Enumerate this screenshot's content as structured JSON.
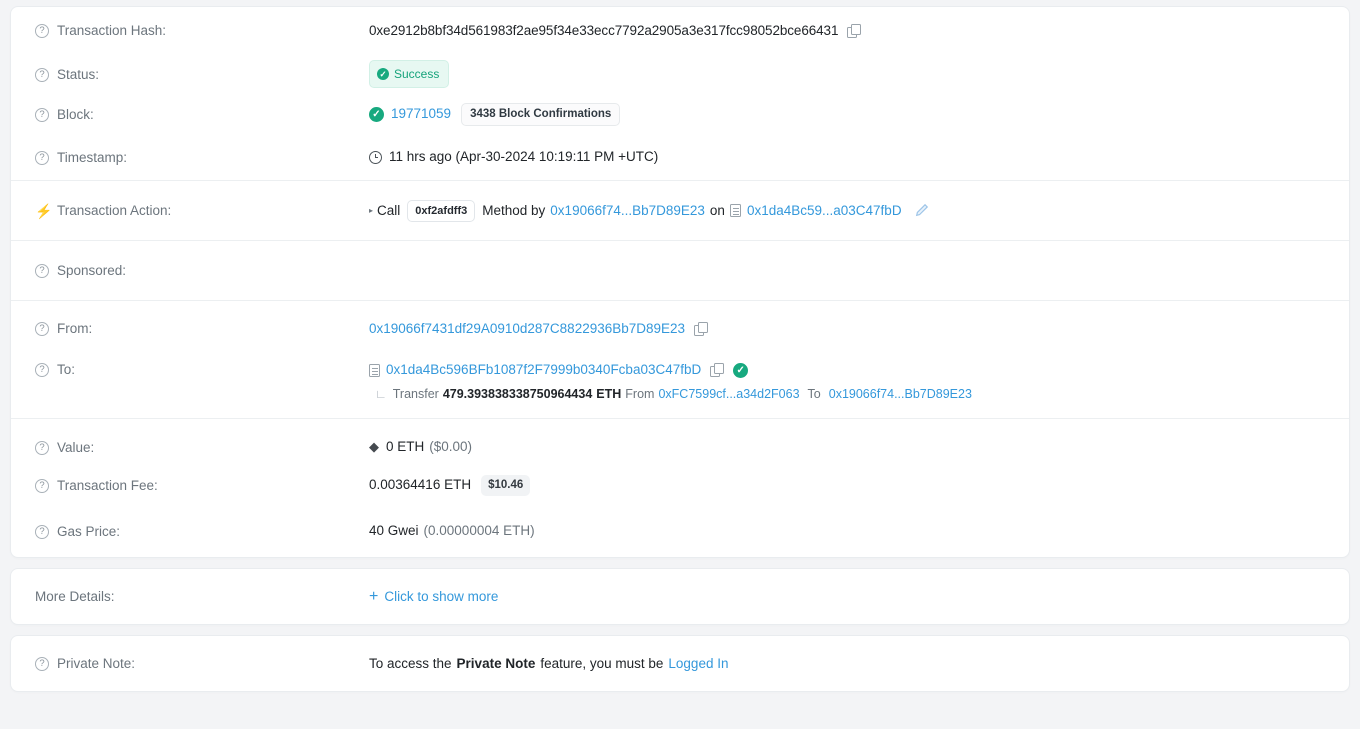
{
  "colors": {
    "link": "#3498db",
    "success": "#17a97f",
    "success_bg": "#e7f8f2",
    "page_bg": "#f3f4f6",
    "label": "#6c757d"
  },
  "rows": {
    "transaction_hash": {
      "label": "Transaction Hash:",
      "value": "0xe2912b8bf34d561983f2ae95f34e33ecc7792a2905a3e317fcc98052bce66431",
      "copy_icon": "copy-icon"
    },
    "status": {
      "label": "Status:",
      "badge": "Success",
      "badge_icon": "check-circle-icon"
    },
    "block": {
      "label": "Block:",
      "number": "19771059",
      "confirmations": "3438 Block Confirmations",
      "icon": "check-circle-icon"
    },
    "timestamp": {
      "label": "Timestamp:",
      "icon": "clock-icon",
      "value": "11 hrs ago (Apr-30-2024 10:19:11 PM +UTC)"
    },
    "transaction_action": {
      "label": "Transaction Action:",
      "icon": "lightning-bolt-icon",
      "caret": "▸",
      "call_text": "Call",
      "method_sig": "0xf2afdff3",
      "method_by_text": "Method by",
      "caller": "0x19066f74...Bb7D89E23",
      "on_text": "on",
      "contract": "0x1da4Bc59...a03C47fbD",
      "edit_icon": "pencil-icon"
    },
    "sponsored": {
      "label": "Sponsored:",
      "value": ""
    },
    "from": {
      "label": "From:",
      "address": "0x19066f7431df29A0910d287C8822936Bb7D89E23",
      "copy_icon": "copy-icon"
    },
    "to": {
      "label": "To:",
      "address": "0x1da4Bc596BFb1087f2F7999b0340Fcba03C47fbD",
      "contract_icon": "contract-doc-icon",
      "copy_icon": "copy-icon",
      "verified_icon": "check-circle-icon",
      "transfer": {
        "prefix": "Transfer",
        "amount": "479.393838338750964434",
        "unit": "ETH",
        "from_text": "From",
        "from_address": "0xFC7599cf...a34d2F063",
        "to_text": "To",
        "to_address": "0x19066f74...Bb7D89E23"
      }
    },
    "value": {
      "label": "Value:",
      "icon": "ethereum-diamond-icon",
      "amount": "0 ETH",
      "usd": "($0.00)"
    },
    "transaction_fee": {
      "label": "Transaction Fee:",
      "amount": "0.00364416 ETH",
      "usd_badge": "$10.46"
    },
    "gas_price": {
      "label": "Gas Price:",
      "amount": "40 Gwei",
      "eth": "(0.00000004 ETH)"
    },
    "more_details": {
      "label": "More Details:",
      "link": "Click to show more",
      "plus_icon": "plus-icon"
    },
    "private_note": {
      "label": "Private Note:",
      "text_before": "To access the",
      "bold_text": "Private Note",
      "text_middle": "feature, you must be",
      "link": "Logged In"
    }
  }
}
